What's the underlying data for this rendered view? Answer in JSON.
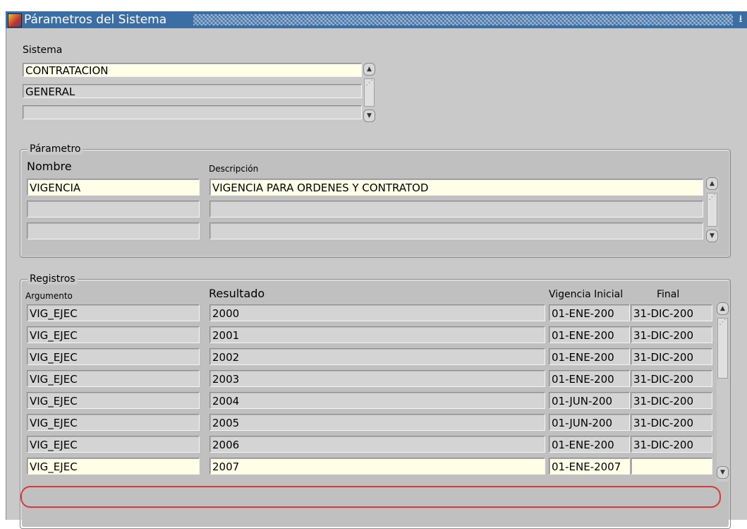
{
  "window": {
    "title": "Párametros del Sistema",
    "min_glyph": "⭳"
  },
  "sistema": {
    "label": "Sistema",
    "rows": [
      "CONTRATACION",
      "GENERAL",
      ""
    ]
  },
  "parametro": {
    "legend": "Párametro",
    "col_nombre": "Nombre",
    "col_descripcion": "Descripción",
    "rows": [
      {
        "nombre": "VIGENCIA",
        "descripcion": "VIGENCIA PARA ORDENES Y CONTRATOD"
      },
      {
        "nombre": "",
        "descripcion": ""
      },
      {
        "nombre": "",
        "descripcion": ""
      }
    ]
  },
  "registros": {
    "legend": "Registros",
    "col_argumento": "Argumento",
    "col_resultado": "Resultado",
    "col_vig_inicial": "Vigencia Inicial",
    "col_final": "Final",
    "rows": [
      {
        "argumento": "VIG_EJEC",
        "resultado": "2000",
        "inicial": "01-ENE-200",
        "final": "31-DIC-200"
      },
      {
        "argumento": "VIG_EJEC",
        "resultado": "2001",
        "inicial": "01-ENE-200",
        "final": "31-DIC-200"
      },
      {
        "argumento": "VIG_EJEC",
        "resultado": "2002",
        "inicial": "01-ENE-200",
        "final": "31-DIC-200"
      },
      {
        "argumento": "VIG_EJEC",
        "resultado": "2003",
        "inicial": "01-ENE-200",
        "final": "31-DIC-200"
      },
      {
        "argumento": "VIG_EJEC",
        "resultado": "2004",
        "inicial": "01-JUN-200",
        "final": "31-DIC-200"
      },
      {
        "argumento": "VIG_EJEC",
        "resultado": "2005",
        "inicial": "01-JUN-200",
        "final": "31-DIC-200"
      },
      {
        "argumento": "VIG_EJEC",
        "resultado": "2006",
        "inicial": "01-ENE-200",
        "final": "31-DIC-200"
      },
      {
        "argumento": "VIG_EJEC",
        "resultado": "2007",
        "inicial": "01-ENE-2007",
        "final": ""
      }
    ]
  },
  "colors": {
    "title_bar": "#3a6ea5",
    "active_field": "#ffffe8",
    "highlight": "#d9383a"
  }
}
